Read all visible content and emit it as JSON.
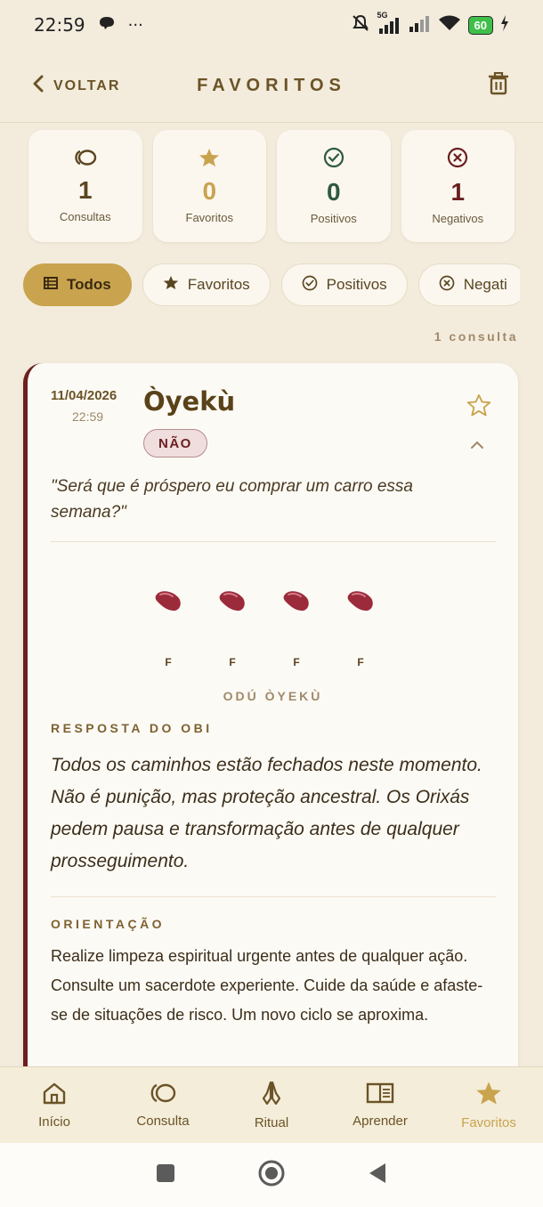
{
  "status_bar": {
    "time": "22:59",
    "more": "···",
    "network": "5G",
    "battery": "60"
  },
  "header": {
    "back_label": "VOLTAR",
    "title": "FAVORITOS"
  },
  "stats": [
    {
      "icon": "oval-rings-icon",
      "value": "1",
      "label": "Consultas",
      "color": "#5a4520"
    },
    {
      "icon": "star-icon",
      "value": "0",
      "label": "Favoritos",
      "color": "#c9a34e"
    },
    {
      "icon": "check-circle-icon",
      "value": "0",
      "label": "Positivos",
      "color": "#2e5a3e"
    },
    {
      "icon": "x-circle-icon",
      "value": "1",
      "label": "Negativos",
      "color": "#6b1f1f"
    }
  ],
  "filters": [
    {
      "icon": "list-icon",
      "label": "Todos",
      "active": true
    },
    {
      "icon": "star-icon",
      "label": "Favoritos",
      "active": false
    },
    {
      "icon": "check-circle-icon",
      "label": "Positivos",
      "active": false
    },
    {
      "icon": "x-circle-icon",
      "label": "Negati",
      "active": false
    }
  ],
  "result_count": "1 consulta",
  "card": {
    "date": "11/04/2026",
    "time": "22:59",
    "odu_name": "Òyekù",
    "badge": "NÃO",
    "question": "\"Será que é próspero eu comprar um carro essa semana?\"",
    "beans": [
      "F",
      "F",
      "F",
      "F"
    ],
    "odu_label": "ODÚ ÒYEKÙ",
    "answer_title": "RESPOSTA DO OBI",
    "answer": "Todos os caminhos estão fechados neste momento. Não é punição, mas proteção ancestral. Os Orixás pedem pausa e transformação antes de qualquer prosseguimento.",
    "guidance_title": "ORIENTAÇÃO",
    "guidance": "Realize limpeza espiritual urgente antes de qualquer ação. Consulte um sacerdote experiente. Cuide da saúde e afaste-se de situações de risco. Um novo ciclo se aproxima."
  },
  "bottom_nav": [
    {
      "icon": "home-icon",
      "label": "Início",
      "active": false
    },
    {
      "icon": "oval-rings-icon",
      "label": "Consulta",
      "active": false
    },
    {
      "icon": "praying-hands-icon",
      "label": "Ritual",
      "active": false
    },
    {
      "icon": "book-icon",
      "label": "Aprender",
      "active": false
    },
    {
      "icon": "star-icon",
      "label": "Favoritos",
      "active": true
    }
  ],
  "colors": {
    "accent": "#c9a34e",
    "brown": "#6b5326",
    "negative": "#6b1f1f",
    "positive": "#2e5a3e",
    "background": "#f3ecdd"
  }
}
